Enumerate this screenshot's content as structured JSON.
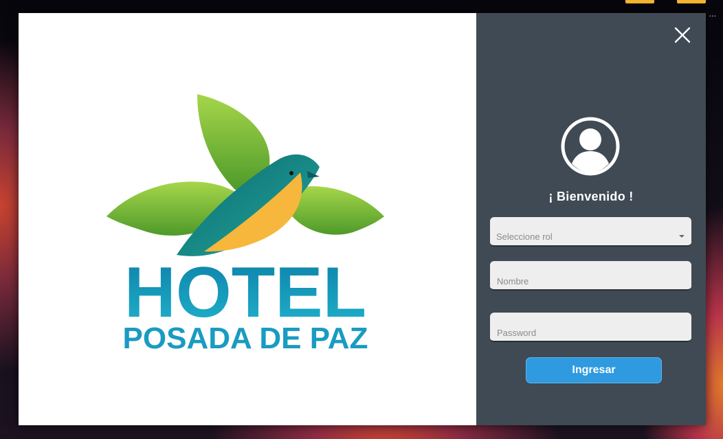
{
  "login": {
    "welcome": "¡ Bienvenido !",
    "role_select": {
      "placeholder": "Seleccione rol",
      "selected": ""
    },
    "name_field": {
      "placeholder": "Nombre",
      "value": ""
    },
    "password_field": {
      "placeholder": "Password",
      "value": ""
    },
    "submit_label": "Ingresar"
  },
  "logo": {
    "line1": "HOTEL",
    "line2": "POSADA DE PAZ"
  },
  "desktop": {
    "ellipsis": "..."
  },
  "colors": {
    "login_panel_bg": "#3f4a54",
    "button_bg": "#2f9ae0",
    "logo_teal": "#1a9bc1",
    "leaf_green": "#7cc142"
  },
  "icons": {
    "close": "close-icon",
    "avatar": "user-circle-icon",
    "dropdown": "chevron-down-icon"
  }
}
